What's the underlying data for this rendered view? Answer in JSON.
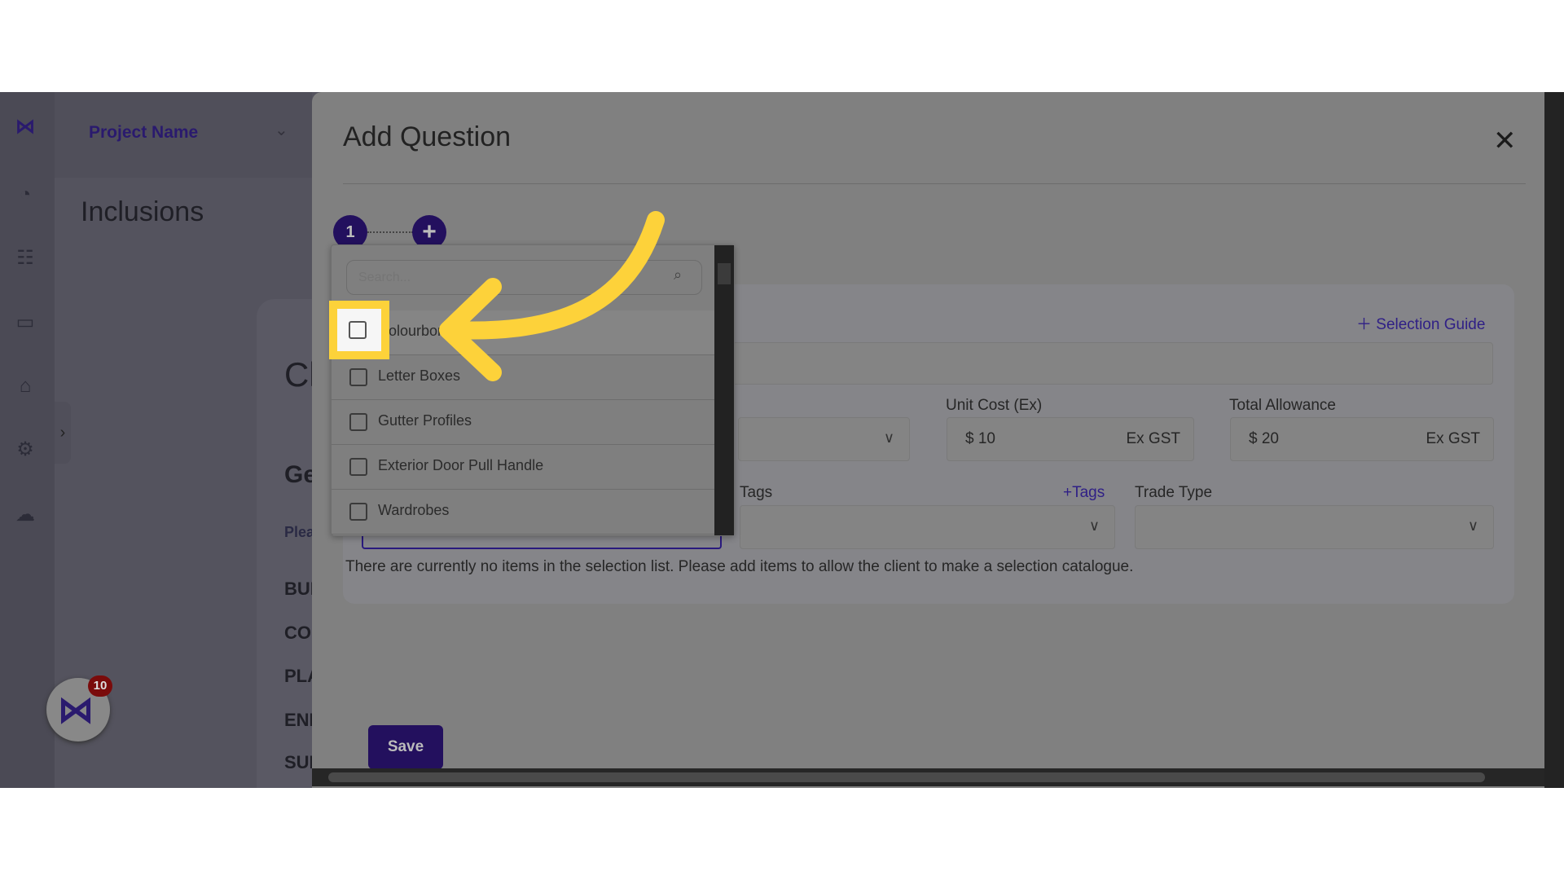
{
  "sidebar": {
    "icons": [
      "logo-icon",
      "dashboard-icon",
      "users-icon",
      "chart-icon",
      "presentation-icon",
      "settings-icon",
      "cloud-network-icon"
    ]
  },
  "header": {
    "project_name": "Project Name"
  },
  "page": {
    "title": "Inclusions",
    "card_title": "Cl",
    "section_title": "Ge",
    "hint": "Plea",
    "rows": [
      "BUI",
      "CO",
      "PLA",
      "ENE",
      "SUF"
    ]
  },
  "fab": {
    "badge": "10"
  },
  "modal": {
    "title": "Add Question",
    "close": "✕",
    "step1": "1",
    "add_step": "+",
    "selection_guide": "Selection Guide",
    "unit_cost_label": "Unit Cost (Ex)",
    "unit_cost_value": "$ 10",
    "unit_cost_suffix": "Ex GST",
    "total_label": "Total Allowance",
    "total_value": "$ 20",
    "total_suffix": "Ex GST",
    "tags_label": "Tags",
    "add_tags": "Tags",
    "trade_label": "Trade Type",
    "empty_message": "There are currently no items in the selection list. Please add items to allow the client to make a selection catalogue.",
    "save": "Save"
  },
  "dropdown": {
    "search_placeholder": "Search...",
    "items": [
      "Colourbond",
      "Letter Boxes",
      "Gutter Profiles",
      "Exterior Door Pull Handle",
      "Wardrobes"
    ]
  },
  "colors": {
    "accent": "#3b1fa8",
    "annotation": "#fdd23a"
  }
}
